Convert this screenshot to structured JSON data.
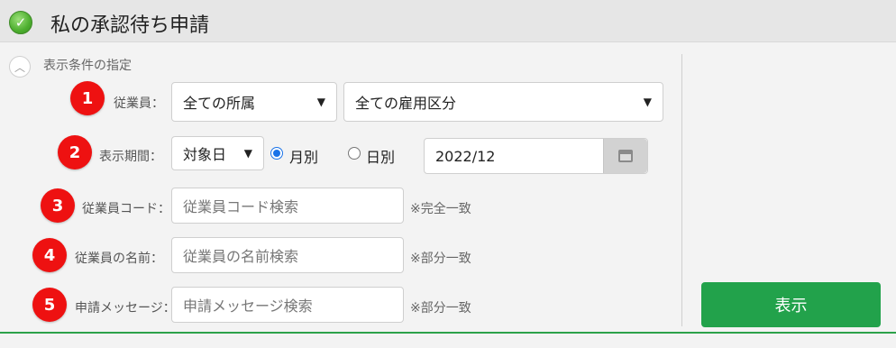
{
  "header": {
    "title": "私の承認待ち申請",
    "icon": "check-circle-icon"
  },
  "conditions": {
    "label": "表示条件の指定",
    "toggle_icon": "chevron-up-icon"
  },
  "rows": {
    "employee": {
      "badge": "1",
      "label": "従業員：",
      "affiliation": "全ての所属",
      "employment_type": "全ての雇用区分"
    },
    "period": {
      "badge": "2",
      "label": "表示期間：",
      "basis": "対象日",
      "radio_month": "月別",
      "radio_day": "日別",
      "selected": "月別",
      "date": "2022/12"
    },
    "code": {
      "badge": "3",
      "label": "従業員コード：",
      "placeholder": "従業員コード検索",
      "note": "※完全一致"
    },
    "name": {
      "badge": "4",
      "label": "従業員の名前：",
      "placeholder": "従業員の名前検索",
      "note": "※部分一致"
    },
    "message": {
      "badge": "5",
      "label": "申請メッセージ：",
      "placeholder": "申請メッセージ検索",
      "note": "※部分一致"
    }
  },
  "actions": {
    "show_label": "表示"
  },
  "colors": {
    "accent": "#22a24b",
    "badge": "#ee1111",
    "radio": "#1a73e8"
  }
}
